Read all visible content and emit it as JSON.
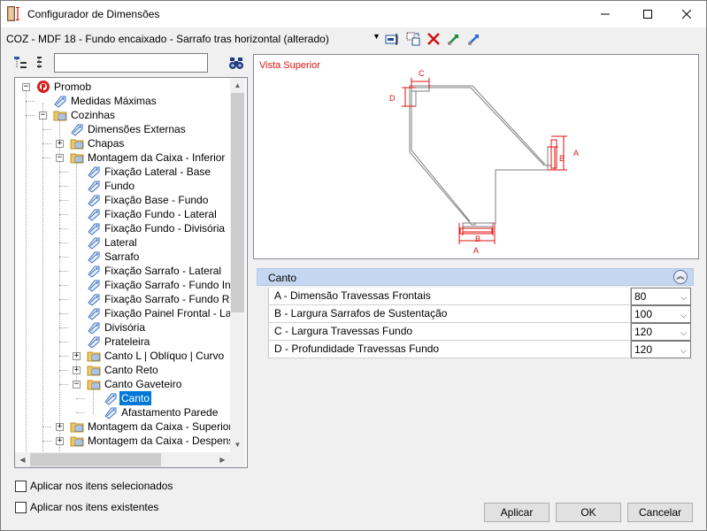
{
  "window": {
    "title": "Configurador de Dimensões"
  },
  "config": {
    "name": "COZ - MDF 18 - Fundo encaixado - Sarrafo tras horizontal (alterado)"
  },
  "search": {
    "value": "",
    "placeholder": ""
  },
  "tree": {
    "items": [
      {
        "label": "Promob"
      },
      {
        "label": "Medidas Máximas"
      },
      {
        "label": "Cozinhas"
      },
      {
        "label": "Dimensões Externas"
      },
      {
        "label": "Chapas"
      },
      {
        "label": "Montagem da Caixa - Inferior"
      },
      {
        "label": "Fixação Lateral - Base"
      },
      {
        "label": "Fundo"
      },
      {
        "label": "Fixação Base - Fundo"
      },
      {
        "label": "Fixação Fundo - Lateral"
      },
      {
        "label": "Fixação Fundo - Divisória"
      },
      {
        "label": "Lateral"
      },
      {
        "label": "Sarrafo"
      },
      {
        "label": "Fixação Sarrafo - Lateral"
      },
      {
        "label": "Fixação Sarrafo - Fundo Inteiro"
      },
      {
        "label": "Fixação Sarrafo - Fundo Rebaixado"
      },
      {
        "label": "Fixação Painel Frontal - Lateral"
      },
      {
        "label": "Divisória"
      },
      {
        "label": "Prateleira"
      },
      {
        "label": "Canto L | Oblíquo | Curvo"
      },
      {
        "label": "Canto Reto"
      },
      {
        "label": "Canto Gaveteiro"
      },
      {
        "label": "Canto"
      },
      {
        "label": "Afastamento Parede"
      },
      {
        "label": "Montagem da Caixa - Superior"
      },
      {
        "label": "Montagem da Caixa - Despenseiro"
      }
    ]
  },
  "preview": {
    "title": "Vista Superior",
    "dim_labels": {
      "a": "A",
      "b": "B",
      "c": "C",
      "d": "D"
    },
    "colors": {
      "dimension": "#e01010",
      "outline": "#7f7f7f"
    }
  },
  "properties": {
    "header": "Canto",
    "rows": [
      {
        "label": "A - Dimensão Travessas Frontais",
        "value": "80"
      },
      {
        "label": "B - Largura Sarrafos de Sustentação",
        "value": "100"
      },
      {
        "label": "C - Largura Travessas Fundo",
        "value": "120"
      },
      {
        "label": "D - Profundidade Travessas Fundo",
        "value": "120"
      }
    ]
  },
  "options": {
    "apply_selected": "Aplicar nos itens selecionados",
    "apply_existing": "Aplicar nos itens existentes"
  },
  "buttons": {
    "apply": "Aplicar",
    "ok": "OK",
    "cancel": "Cancelar"
  }
}
